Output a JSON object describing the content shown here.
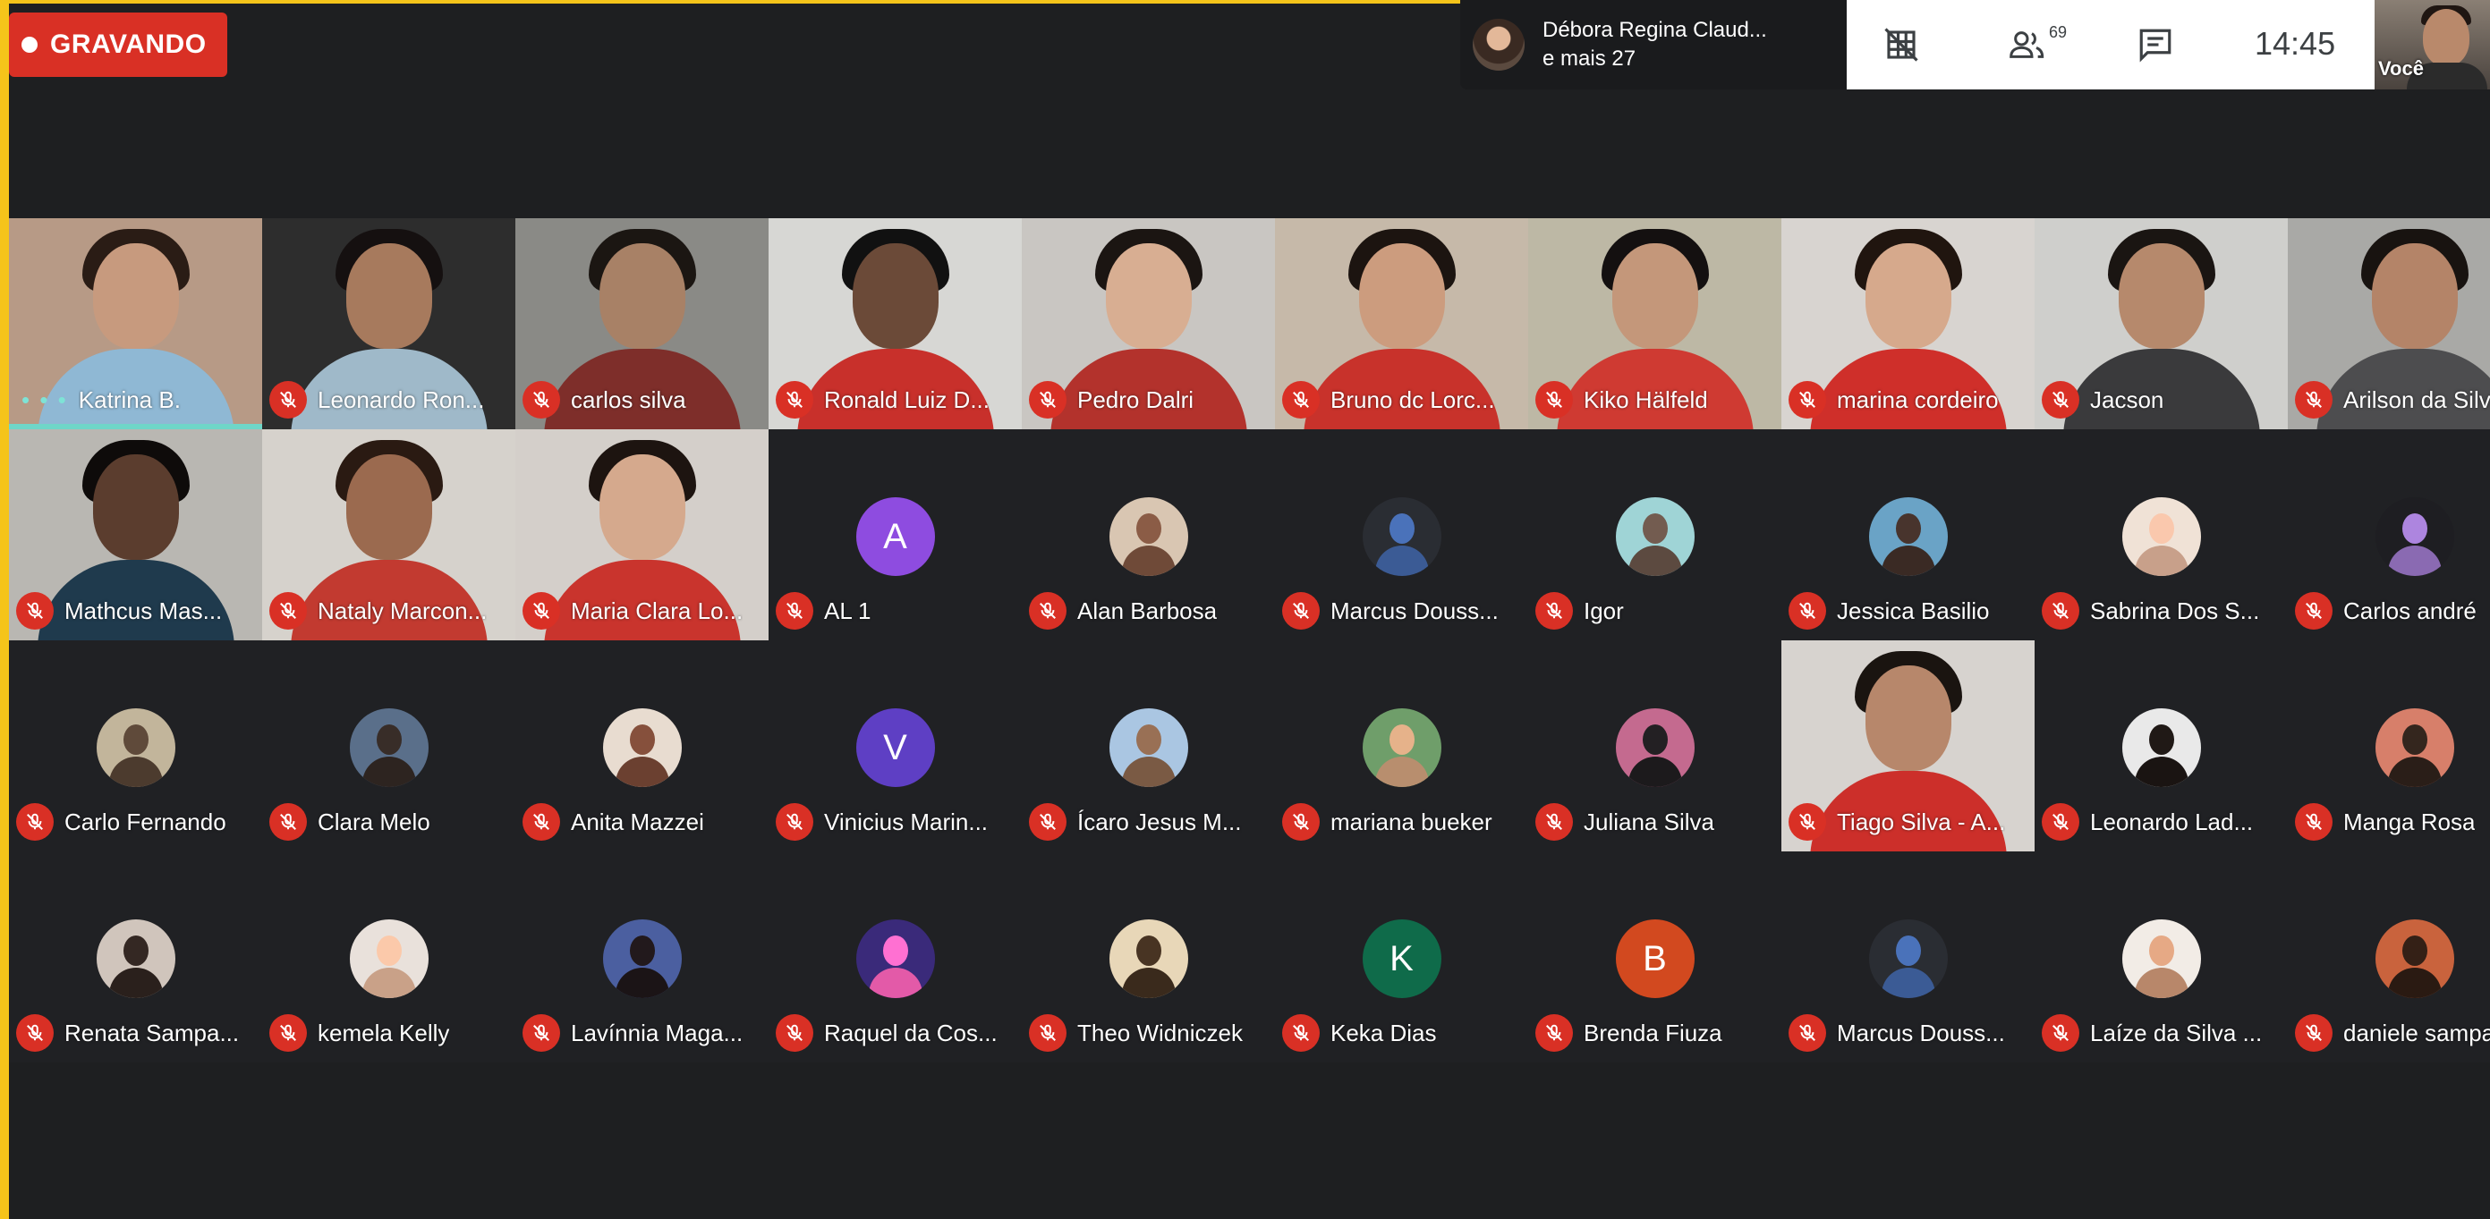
{
  "recording": {
    "label": "GRAVANDO",
    "color": "#d93025"
  },
  "active_speaker": {
    "line1": "Débora Regina Claud...",
    "line2": "e mais 27"
  },
  "toolbar": {
    "participants_count": "69",
    "clock": "14:45",
    "icons": [
      "grid-off-icon",
      "people-icon",
      "chat-icon"
    ]
  },
  "self_view": {
    "label": "Você"
  },
  "rows": [
    [
      {
        "name": "Katrina B.",
        "type": "video",
        "muted": false,
        "speaking": true,
        "bg": "#b79a86",
        "hair": "#2a1c15",
        "skin": "#c79a7e",
        "shirt": "#8fb8d4"
      },
      {
        "name": "Leonardo Ron...",
        "type": "video",
        "muted": true,
        "bg": "#2d2d2d",
        "hair": "#151010",
        "skin": "#a77a5d",
        "shirt": "#9fb9c9"
      },
      {
        "name": "carlos silva",
        "type": "video",
        "muted": true,
        "bg": "#8a8a86",
        "hair": "#1b1612",
        "skin": "#a88166",
        "shirt": "#7e2e2a"
      },
      {
        "name": "Ronald Luiz D...",
        "type": "video",
        "muted": true,
        "bg": "#d7d7d4",
        "hair": "#111",
        "skin": "#6b4a38",
        "shirt": "#c8302b"
      },
      {
        "name": "Pedro Dalri",
        "type": "video",
        "muted": true,
        "bg": "#c9c6c2",
        "hair": "#1b1512",
        "skin": "#d8ae92",
        "shirt": "#b3322c"
      },
      {
        "name": "Bruno dc Lorc...",
        "type": "video",
        "muted": true,
        "bg": "#c6b9a9",
        "hair": "#1c1410",
        "skin": "#cc9c7e",
        "shirt": "#c8322b"
      },
      {
        "name": "Kiko Hälfeld",
        "type": "video",
        "muted": true,
        "bg": "#bdb8a5",
        "hair": "#141010",
        "skin": "#c4977a",
        "shirt": "#cf3a32"
      },
      {
        "name": "marina cordeiro",
        "type": "video",
        "muted": true,
        "bg": "#d8d4d0",
        "hair": "#20150f",
        "skin": "#d6a98c",
        "shirt": "#cf2f2a"
      },
      {
        "name": "Jacson",
        "type": "video",
        "muted": true,
        "bg": "#cfcfcc",
        "hair": "#1a1512",
        "skin": "#b6896c",
        "shirt": "#3a3a3c"
      },
      {
        "name": "Arilson da Silva",
        "type": "video",
        "muted": true,
        "bg": "#a9a9a6",
        "hair": "#181310",
        "skin": "#b48468",
        "shirt": "#4d4d4f"
      }
    ],
    [
      {
        "name": "Mathcus Mas...",
        "type": "video",
        "muted": true,
        "bg": "#b9b7b2",
        "hair": "#0e0b0a",
        "skin": "#5b3d2e",
        "shirt": "#1f3a4d"
      },
      {
        "name": "Nataly Marcon...",
        "type": "video",
        "muted": true,
        "bg": "#d6d2cc",
        "hair": "#2a1a12",
        "skin": "#9b6a4f",
        "shirt": "#c23a30"
      },
      {
        "name": "Maria Clara Lo...",
        "type": "video",
        "muted": true,
        "bg": "#d4cfca",
        "hair": "#1d1410",
        "skin": "#d5a98d",
        "shirt": "#c9342d"
      },
      {
        "name": "AL 1",
        "type": "letter",
        "letter": "A",
        "color": "#8e4ce0",
        "muted": true
      },
      {
        "name": "Alan Barbosa",
        "type": "photo",
        "muted": true,
        "c1": "#6f4a38",
        "c2": "#d9c6b2"
      },
      {
        "name": "Marcus Douss...",
        "type": "photo",
        "muted": true,
        "c1": "#3b5b95",
        "c2": "#2a2d33"
      },
      {
        "name": "Igor",
        "type": "photo",
        "muted": true,
        "c1": "#5c4a40",
        "c2": "#9fd4d6"
      },
      {
        "name": "Jessica Basilio",
        "type": "photo",
        "muted": true,
        "c1": "#3a2a24",
        "c2": "#6aa3c6"
      },
      {
        "name": "Sabrina Dos S...",
        "type": "photo",
        "muted": true,
        "c1": "#c8a08a",
        "c2": "#f0e2d6"
      },
      {
        "name": "Carlos andré",
        "type": "photo",
        "muted": true,
        "c1": "#8a6ab2",
        "c2": "#1e1e22"
      }
    ],
    [
      {
        "name": "Carlo Fernando",
        "type": "photo",
        "muted": true,
        "c1": "#4c3b2e",
        "c2": "#c2b59b"
      },
      {
        "name": "Clara Melo",
        "type": "photo",
        "muted": true,
        "c1": "#2d2420",
        "c2": "#5a6f8a"
      },
      {
        "name": "Anita Mazzei",
        "type": "photo",
        "muted": true,
        "c1": "#6b4030",
        "c2": "#e8dcd0"
      },
      {
        "name": "Vinicius Marin...",
        "type": "letter",
        "letter": "V",
        "color": "#5e3fc4",
        "muted": true
      },
      {
        "name": "Ícaro Jesus M...",
        "type": "photo",
        "muted": true,
        "c1": "#7a5a44",
        "c2": "#aac6e2"
      },
      {
        "name": "mariana bueker",
        "type": "photo",
        "muted": true,
        "c1": "#b88e6e",
        "c2": "#6f9e6a"
      },
      {
        "name": "Juliana Silva",
        "type": "photo",
        "muted": true,
        "c1": "#1c1a1c",
        "c2": "#c46a8f"
      },
      {
        "name": "Tiago Silva - A...",
        "type": "video",
        "muted": true,
        "bg": "#d7d3cf",
        "hair": "#1a1410",
        "skin": "#b7876b",
        "shirt": "#cc2f2a"
      },
      {
        "name": "Leonardo Lad...",
        "type": "photo",
        "muted": true,
        "c1": "#1a1412",
        "c2": "#e9e9e9"
      },
      {
        "name": "Manga Rosa",
        "type": "photo",
        "muted": true,
        "c1": "#2a1e18",
        "c2": "#d77f6a"
      }
    ],
    [
      {
        "name": "Renata Sampa...",
        "type": "photo",
        "muted": true,
        "c1": "#2a201c",
        "c2": "#d0c5bc"
      },
      {
        "name": "kemela Kelly",
        "type": "photo",
        "muted": true,
        "c1": "#c9a188",
        "c2": "#e9e1db"
      },
      {
        "name": "Lavínnia Maga...",
        "type": "photo",
        "muted": true,
        "c1": "#1b1416",
        "c2": "#4b5fa0"
      },
      {
        "name": "Raquel da Cos...",
        "type": "photo",
        "muted": true,
        "c1": "#e35aa8",
        "c2": "#3a2a7a"
      },
      {
        "name": "Theo Widniczek",
        "type": "photo",
        "muted": true,
        "c1": "#3a2a1c",
        "c2": "#e8d7b8"
      },
      {
        "name": "Keka Dias",
        "type": "letter",
        "letter": "K",
        "color": "#0f6b4a",
        "muted": true
      },
      {
        "name": "Brenda Fiuza",
        "type": "letter",
        "letter": "B",
        "color": "#d2491f",
        "muted": true
      },
      {
        "name": "Marcus Douss...",
        "type": "photo",
        "muted": true,
        "c1": "#3b5b95",
        "c2": "#2a2d33"
      },
      {
        "name": "Laíze da Silva ...",
        "type": "photo",
        "muted": true,
        "c1": "#b8876a",
        "c2": "#f2ece6"
      },
      {
        "name": "daniele sampa",
        "type": "photo",
        "muted": true,
        "c1": "#2a1a12",
        "c2": "#c9633d"
      }
    ]
  ]
}
